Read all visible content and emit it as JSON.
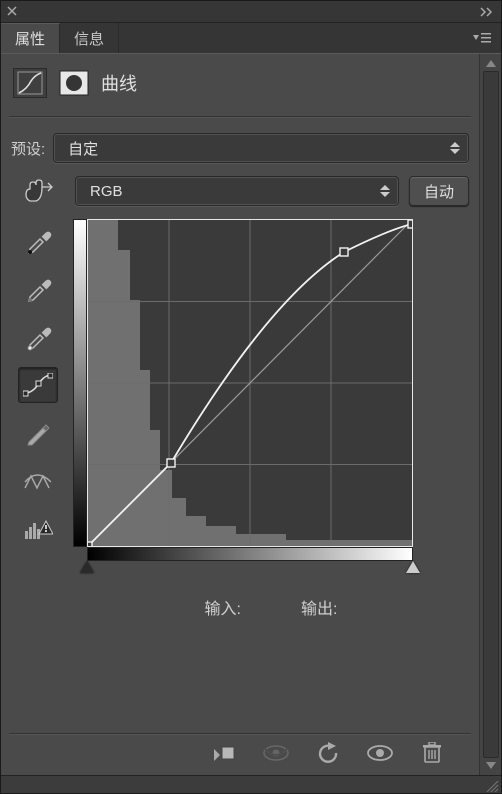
{
  "tabs": {
    "properties": "属性",
    "info": "信息"
  },
  "header": {
    "title": "曲线"
  },
  "preset": {
    "label": "预设:",
    "value": "自定"
  },
  "channel": {
    "value": "RGB",
    "auto_label": "自动"
  },
  "io": {
    "input_label": "输入:",
    "output_label": "输出:"
  },
  "icons": {
    "curves_adjustment": "curves-adjustment-icon",
    "layer_mask": "layer-mask-icon",
    "hand": "hand-target-icon",
    "eyedropper_black": "eyedropper-black-icon",
    "eyedropper_gray": "eyedropper-gray-icon",
    "eyedropper_white": "eyedropper-white-icon",
    "curve_tool": "curve-point-icon",
    "pencil": "pencil-icon",
    "smooth": "smooth-curve-icon",
    "clip_warning": "clip-warning-icon",
    "clip_to_layer": "clip-to-layer-icon",
    "view_previous": "view-previous-icon",
    "reset": "reset-icon",
    "visibility": "visibility-icon",
    "trash": "trash-icon"
  },
  "colors": {
    "panel_bg": "#4a4a4a",
    "dropdown_bg": "#3a3a3a",
    "text": "#d0d0d0"
  },
  "chart_data": {
    "type": "line",
    "title": "",
    "xlabel": "输入",
    "ylabel": "输出",
    "xlim": [
      0,
      255
    ],
    "ylim": [
      0,
      255
    ],
    "series": [
      {
        "name": "diagonal-baseline",
        "x": [
          0,
          255
        ],
        "y": [
          0,
          255
        ]
      },
      {
        "name": "curve",
        "control_points": [
          {
            "x": 0,
            "y": 0
          },
          {
            "x": 65,
            "y": 65
          },
          {
            "x": 201,
            "y": 230
          },
          {
            "x": 255,
            "y": 252
          }
        ]
      }
    ],
    "histogram_hint": "dark-skewed"
  }
}
